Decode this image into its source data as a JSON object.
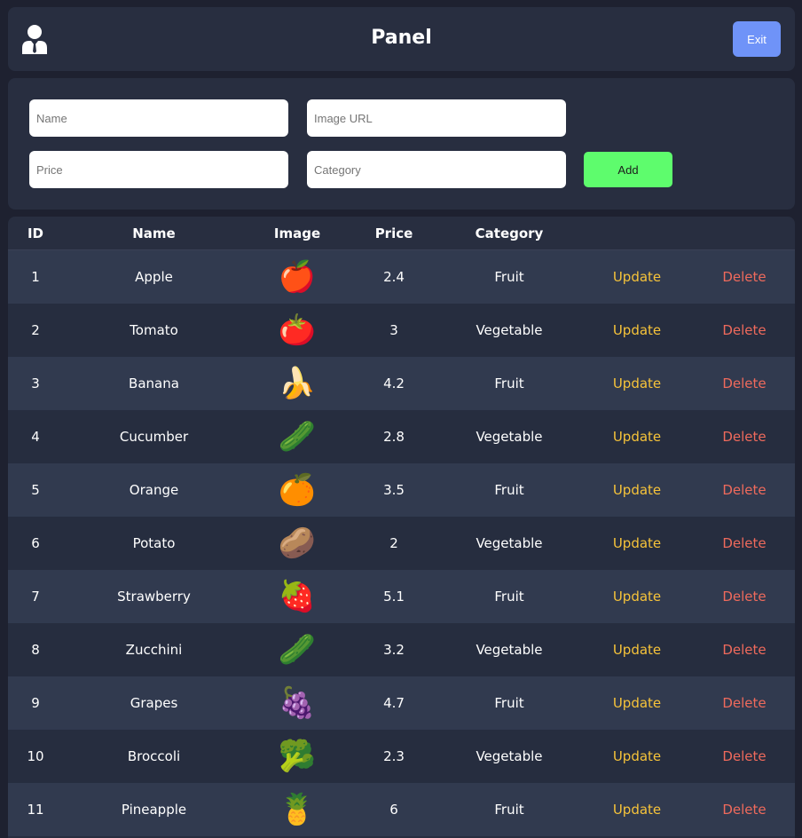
{
  "header": {
    "title": "Panel",
    "exit_label": "Exit",
    "user_icon": "user-icon"
  },
  "form": {
    "name_placeholder": "Name",
    "image_placeholder": "Image URL",
    "price_placeholder": "Price",
    "category_placeholder": "Category",
    "add_label": "Add"
  },
  "table": {
    "columns": [
      "ID",
      "Name",
      "Image",
      "Price",
      "Category"
    ],
    "update_label": "Update",
    "delete_label": "Delete",
    "rows": [
      {
        "id": "1",
        "name": "Apple",
        "image": "🍎",
        "price": "2.4",
        "category": "Fruit"
      },
      {
        "id": "2",
        "name": "Tomato",
        "image": "🍅",
        "price": "3",
        "category": "Vegetable"
      },
      {
        "id": "3",
        "name": "Banana",
        "image": "🍌",
        "price": "4.2",
        "category": "Fruit"
      },
      {
        "id": "4",
        "name": "Cucumber",
        "image": "🥒",
        "price": "2.8",
        "category": "Vegetable"
      },
      {
        "id": "5",
        "name": "Orange",
        "image": "🍊",
        "price": "3.5",
        "category": "Fruit"
      },
      {
        "id": "6",
        "name": "Potato",
        "image": "🥔",
        "price": "2",
        "category": "Vegetable"
      },
      {
        "id": "7",
        "name": "Strawberry",
        "image": "🍓",
        "price": "5.1",
        "category": "Fruit"
      },
      {
        "id": "8",
        "name": "Zucchini",
        "image": "🥒",
        "price": "3.2",
        "category": "Vegetable"
      },
      {
        "id": "9",
        "name": "Grapes",
        "image": "🍇",
        "price": "4.7",
        "category": "Fruit"
      },
      {
        "id": "10",
        "name": "Broccoli",
        "image": "🥦",
        "price": "2.3",
        "category": "Vegetable"
      },
      {
        "id": "11",
        "name": "Pineapple",
        "image": "🍍",
        "price": "6",
        "category": "Fruit"
      }
    ]
  },
  "colors": {
    "background": "#1e2130",
    "panel": "#282e40",
    "exit_button": "#6f93f8",
    "add_button": "#5efc6d",
    "update_link": "#f6c33a",
    "delete_link": "#ef6a5c"
  }
}
